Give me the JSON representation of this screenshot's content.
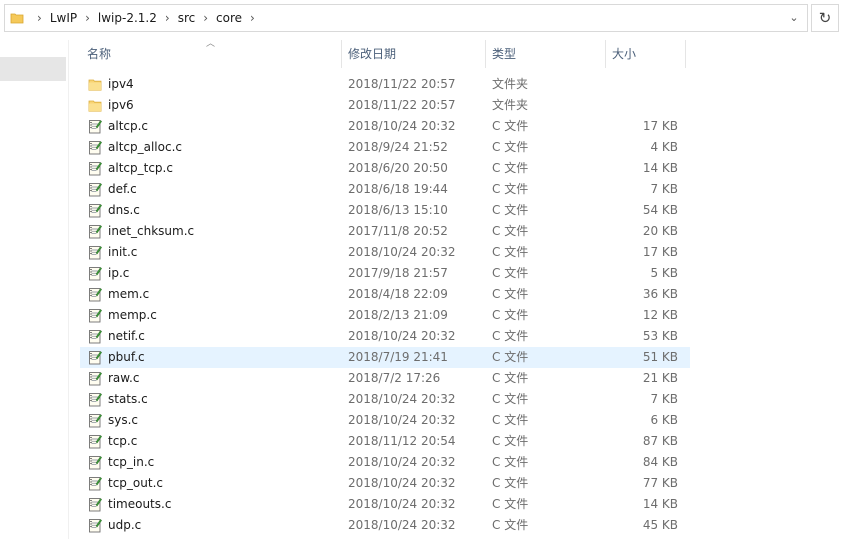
{
  "breadcrumbs": [
    "LwIP",
    "lwip-2.1.2",
    "src",
    "core"
  ],
  "columns": {
    "name": "名称",
    "date": "修改日期",
    "type": "类型",
    "size": "大小"
  },
  "refresh_icon": "↻",
  "dropdown_icon": "⌄",
  "files": [
    {
      "name": "ipv4",
      "date": "2018/11/22 20:57",
      "type": "文件夹",
      "size": "",
      "icon": "folder-icon"
    },
    {
      "name": "ipv6",
      "date": "2018/11/22 20:57",
      "type": "文件夹",
      "size": "",
      "icon": "folder-icon"
    },
    {
      "name": "altcp.c",
      "date": "2018/10/24 20:32",
      "type": "C 文件",
      "size": "17 KB",
      "icon": "c-file-icon"
    },
    {
      "name": "altcp_alloc.c",
      "date": "2018/9/24 21:52",
      "type": "C 文件",
      "size": "4 KB",
      "icon": "c-file-icon"
    },
    {
      "name": "altcp_tcp.c",
      "date": "2018/6/20 20:50",
      "type": "C 文件",
      "size": "14 KB",
      "icon": "c-file-icon"
    },
    {
      "name": "def.c",
      "date": "2018/6/18 19:44",
      "type": "C 文件",
      "size": "7 KB",
      "icon": "c-file-icon"
    },
    {
      "name": "dns.c",
      "date": "2018/6/13 15:10",
      "type": "C 文件",
      "size": "54 KB",
      "icon": "c-file-icon"
    },
    {
      "name": "inet_chksum.c",
      "date": "2017/11/8 20:52",
      "type": "C 文件",
      "size": "20 KB",
      "icon": "c-file-icon"
    },
    {
      "name": "init.c",
      "date": "2018/10/24 20:32",
      "type": "C 文件",
      "size": "17 KB",
      "icon": "c-file-icon"
    },
    {
      "name": "ip.c",
      "date": "2017/9/18 21:57",
      "type": "C 文件",
      "size": "5 KB",
      "icon": "c-file-icon"
    },
    {
      "name": "mem.c",
      "date": "2018/4/18 22:09",
      "type": "C 文件",
      "size": "36 KB",
      "icon": "c-file-icon"
    },
    {
      "name": "memp.c",
      "date": "2018/2/13 21:09",
      "type": "C 文件",
      "size": "12 KB",
      "icon": "c-file-icon"
    },
    {
      "name": "netif.c",
      "date": "2018/10/24 20:32",
      "type": "C 文件",
      "size": "53 KB",
      "icon": "c-file-icon"
    },
    {
      "name": "pbuf.c",
      "date": "2018/7/19 21:41",
      "type": "C 文件",
      "size": "51 KB",
      "icon": "c-file-icon",
      "selected": true
    },
    {
      "name": "raw.c",
      "date": "2018/7/2 17:26",
      "type": "C 文件",
      "size": "21 KB",
      "icon": "c-file-icon"
    },
    {
      "name": "stats.c",
      "date": "2018/10/24 20:32",
      "type": "C 文件",
      "size": "7 KB",
      "icon": "c-file-icon"
    },
    {
      "name": "sys.c",
      "date": "2018/10/24 20:32",
      "type": "C 文件",
      "size": "6 KB",
      "icon": "c-file-icon"
    },
    {
      "name": "tcp.c",
      "date": "2018/11/12 20:54",
      "type": "C 文件",
      "size": "87 KB",
      "icon": "c-file-icon"
    },
    {
      "name": "tcp_in.c",
      "date": "2018/10/24 20:32",
      "type": "C 文件",
      "size": "84 KB",
      "icon": "c-file-icon"
    },
    {
      "name": "tcp_out.c",
      "date": "2018/10/24 20:32",
      "type": "C 文件",
      "size": "77 KB",
      "icon": "c-file-icon"
    },
    {
      "name": "timeouts.c",
      "date": "2018/10/24 20:32",
      "type": "C 文件",
      "size": "14 KB",
      "icon": "c-file-icon"
    },
    {
      "name": "udp.c",
      "date": "2018/10/24 20:32",
      "type": "C 文件",
      "size": "45 KB",
      "icon": "c-file-icon"
    }
  ]
}
